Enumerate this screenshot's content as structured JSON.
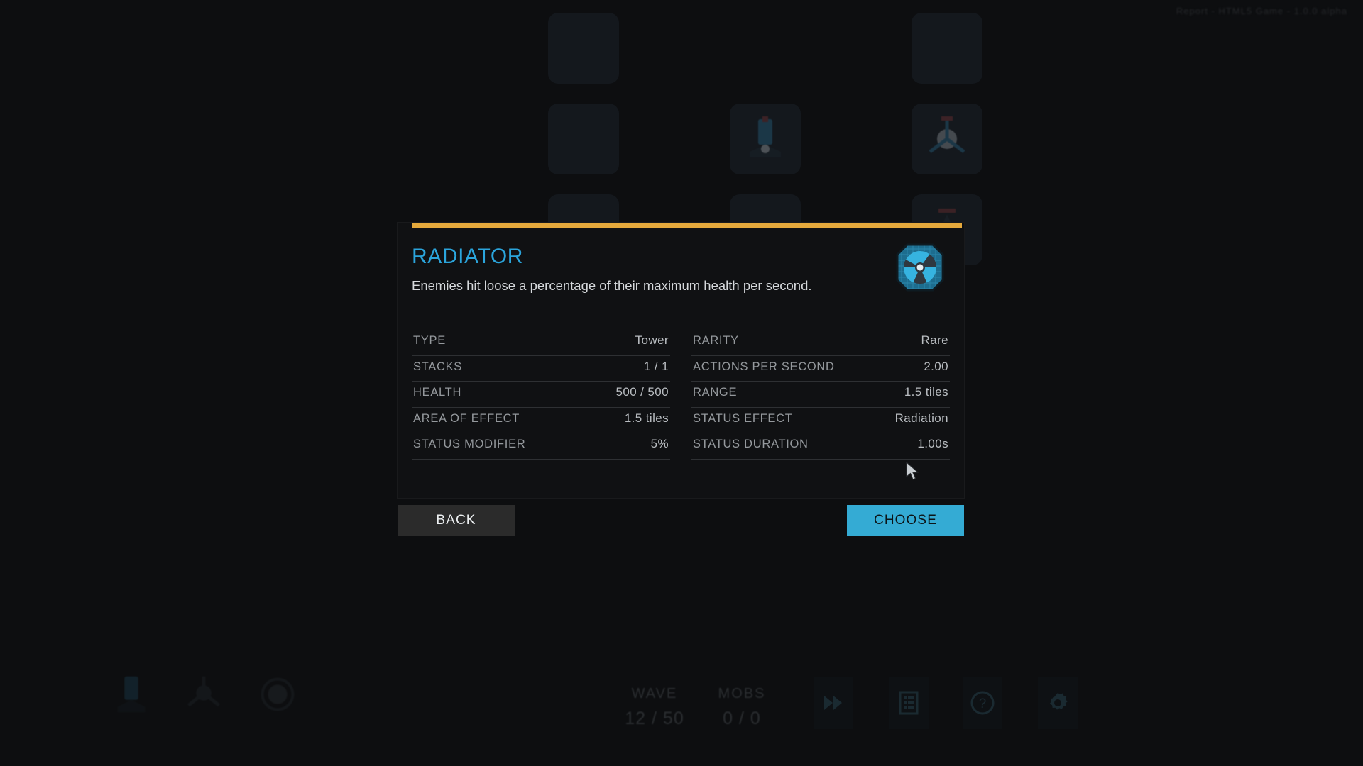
{
  "background": {
    "top_right_text": "Report - HTML5 Game - 1.0.0 alpha",
    "cards": [
      {
        "slot": 1,
        "icon": "empty-card-icon",
        "filled": false
      },
      {
        "slot": 2,
        "icon": "none",
        "filled": false
      },
      {
        "slot": 3,
        "icon": "empty-card-icon",
        "filled": false
      },
      {
        "slot": 4,
        "icon": "empty-card-icon",
        "filled": false
      },
      {
        "slot": 5,
        "icon": "turret-tower-icon",
        "filled": true
      },
      {
        "slot": 6,
        "icon": "radiator-tower-icon",
        "filled": true
      },
      {
        "slot": 7,
        "icon": "empty-card-icon",
        "filled": false
      },
      {
        "slot": 8,
        "icon": "empty-card-icon",
        "filled": false
      },
      {
        "slot": 9,
        "icon": "tripod-tower-icon",
        "filled": true
      }
    ],
    "hud": {
      "towers": [
        "tower-icon-1",
        "tower-icon-2",
        "tower-icon-3"
      ],
      "stats": [
        {
          "key": "WAVE",
          "value": "12 / 50"
        },
        {
          "key": "MOBS",
          "value": "0 / 0"
        }
      ],
      "buttons": [
        {
          "name": "fast-forward-button",
          "icon": "fast-forward-icon"
        },
        {
          "name": "log-button",
          "icon": "list-icon"
        },
        {
          "name": "help-button",
          "icon": "question-mark-icon"
        },
        {
          "name": "settings-button",
          "icon": "gear-icon"
        }
      ]
    }
  },
  "dialog": {
    "accent_color": "#e5a93c",
    "title": "RADIATOR",
    "description": "Enemies hit loose a percentage of their maximum health per second.",
    "icon": "radiation-trefoil-icon",
    "stats_left": [
      {
        "label": "TYPE",
        "value": "Tower"
      },
      {
        "label": "STACKS",
        "value": "1 / 1"
      },
      {
        "label": "HEALTH",
        "value": "500 / 500"
      },
      {
        "label": "AREA OF EFFECT",
        "value": "1.5 tiles"
      },
      {
        "label": "STATUS MODIFIER",
        "value": "5%"
      }
    ],
    "stats_right": [
      {
        "label": "RARITY",
        "value": "Rare"
      },
      {
        "label": "ACTIONS PER SECOND",
        "value": "2.00"
      },
      {
        "label": "RANGE",
        "value": "1.5 tiles"
      },
      {
        "label": "STATUS EFFECT",
        "value": "Radiation"
      },
      {
        "label": "STATUS DURATION",
        "value": "1.00s"
      }
    ],
    "buttons": {
      "back": "BACK",
      "choose": "CHOOSE"
    },
    "colors": {
      "title": "#2ba5dc",
      "choose_bg": "#34abd4",
      "back_bg": "#2b2b2b"
    }
  }
}
